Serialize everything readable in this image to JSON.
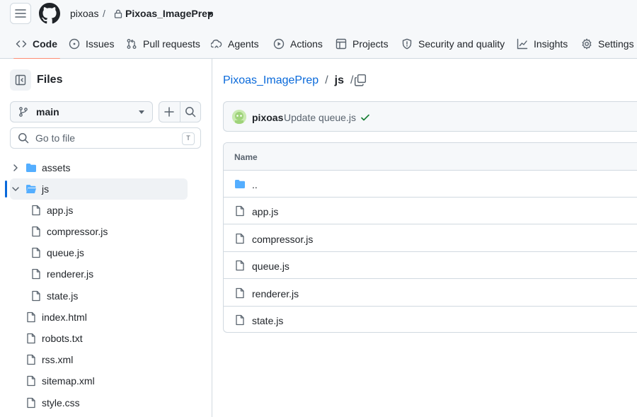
{
  "header": {
    "owner": "pixoas",
    "separator": "/",
    "repo": "Pixoas_ImagePrep"
  },
  "tabs": [
    {
      "label": "Code",
      "icon": "code-icon",
      "active": true
    },
    {
      "label": "Issues",
      "icon": "issue-icon"
    },
    {
      "label": "Pull requests",
      "icon": "pull-request-icon"
    },
    {
      "label": "Agents",
      "icon": "agent-icon"
    },
    {
      "label": "Actions",
      "icon": "play-icon"
    },
    {
      "label": "Projects",
      "icon": "table-icon"
    },
    {
      "label": "Security and quality",
      "icon": "shield-icon"
    },
    {
      "label": "Insights",
      "icon": "graph-icon"
    },
    {
      "label": "Settings",
      "icon": "gear-icon"
    }
  ],
  "sidebar": {
    "title": "Files",
    "branch": "main",
    "goto_placeholder": "Go to file",
    "goto_shortcut": "T",
    "tree": [
      {
        "label": "assets",
        "type": "folder",
        "expanded": false
      },
      {
        "label": "js",
        "type": "folder",
        "expanded": true,
        "selected": true
      },
      {
        "label": "app.js",
        "type": "file",
        "depth": 1
      },
      {
        "label": "compressor.js",
        "type": "file",
        "depth": 1
      },
      {
        "label": "queue.js",
        "type": "file",
        "depth": 1
      },
      {
        "label": "renderer.js",
        "type": "file",
        "depth": 1
      },
      {
        "label": "state.js",
        "type": "file",
        "depth": 1
      },
      {
        "label": "index.html",
        "type": "file"
      },
      {
        "label": "robots.txt",
        "type": "file"
      },
      {
        "label": "rss.xml",
        "type": "file"
      },
      {
        "label": "sitemap.xml",
        "type": "file"
      },
      {
        "label": "style.css",
        "type": "file"
      }
    ]
  },
  "main": {
    "breadcrumb": {
      "repo": "Pixoas_ImagePrep",
      "sep": "/",
      "dir": "js",
      "trailing": "/"
    },
    "commit": {
      "author": "pixoas",
      "message": "Update queue.js",
      "status": "success"
    },
    "table": {
      "header": "Name",
      "rows": [
        {
          "label": "..",
          "type": "folder"
        },
        {
          "label": "app.js",
          "type": "file"
        },
        {
          "label": "compressor.js",
          "type": "file"
        },
        {
          "label": "queue.js",
          "type": "file"
        },
        {
          "label": "renderer.js",
          "type": "file"
        },
        {
          "label": "state.js",
          "type": "file"
        }
      ]
    }
  },
  "colors": {
    "accent": "#0969da",
    "folder": "#54aeff",
    "tab_underline": "#fd8c73",
    "success": "#1a7f37"
  }
}
